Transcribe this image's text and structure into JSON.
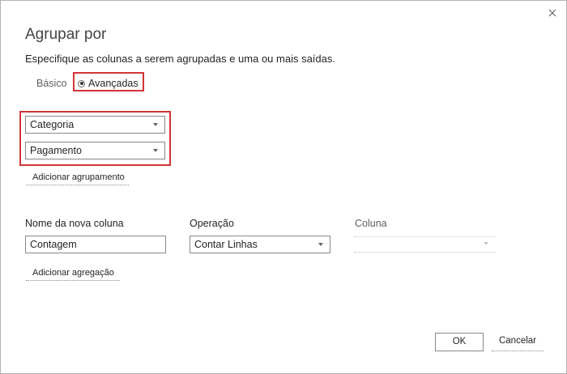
{
  "dialog": {
    "title": "Agrupar por",
    "subtitle": "Especifique as colunas a serem agrupadas e uma ou mais saídas."
  },
  "mode": {
    "basic_label": "Básico",
    "advanced_label": "Avançadas",
    "selected": "Avançadas"
  },
  "grouping": {
    "columns": [
      "Categoria",
      "Pagamento"
    ],
    "add_label": "Adicionar agrupamento"
  },
  "aggregation": {
    "new_column_label": "Nome da nova coluna",
    "operation_label": "Operação",
    "column_label": "Coluna",
    "new_column_value": "Contagem",
    "operation_value": "Contar Linhas",
    "column_value": "",
    "add_label": "Adicionar agregação"
  },
  "footer": {
    "ok_label": "OK",
    "cancel_label": "Cancelar"
  },
  "colors": {
    "highlight": "#d13438",
    "border": "#8a8886"
  },
  "icons": {
    "close": "close-icon",
    "dropdown": "chevron-down-icon"
  }
}
